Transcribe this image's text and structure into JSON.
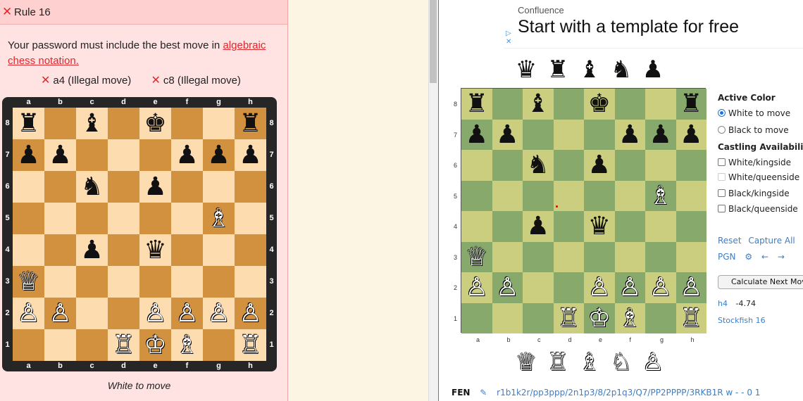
{
  "rule_card": {
    "header_icon": "✕",
    "title": "Rule 16",
    "text_before_link": "Your password must include the best move in ",
    "link_text": "algebraic chess notation.",
    "illegal_moves": [
      {
        "icon": "✕",
        "label": "a4 (Illegal move)"
      },
      {
        "icon": "✕",
        "label": "c8 (Illegal move)"
      }
    ],
    "files": [
      "a",
      "b",
      "c",
      "d",
      "e",
      "f",
      "g",
      "h"
    ],
    "ranks": [
      "8",
      "7",
      "6",
      "5",
      "4",
      "3",
      "2",
      "1"
    ],
    "status": "White to move"
  },
  "position": {
    "a8": "bR",
    "c8": "bB",
    "e8": "bK",
    "h8": "bR",
    "a7": "bP",
    "b7": "bP",
    "f7": "bP",
    "g7": "bP",
    "h7": "bP",
    "c6": "bN",
    "e6": "bP",
    "g5": "wB",
    "c4": "bP",
    "e4": "bQ",
    "a3": "wQ",
    "a2": "wP",
    "b2": "wP",
    "e2": "wP",
    "f2": "wP",
    "g2": "wP",
    "h2": "wP",
    "d1": "wR",
    "e1": "wK",
    "f1": "wB",
    "h1": "wR"
  },
  "ad": {
    "subtitle": "Confluence",
    "title": "Start with a template for free",
    "icons": [
      "▷",
      "✕"
    ]
  },
  "analysis": {
    "captured_white_pieces": [
      "wQ",
      "wR",
      "wB",
      "wN",
      "wP"
    ],
    "captured_black_pieces": [
      "bQ",
      "bR",
      "bB",
      "bN",
      "bP"
    ],
    "board_files": [
      "a",
      "b",
      "c",
      "d",
      "e",
      "f",
      "g",
      "h"
    ],
    "board_ranks": [
      "8",
      "7",
      "6",
      "5",
      "4",
      "3",
      "2",
      "1"
    ],
    "active_color_heading": "Active Color",
    "active_color_options": [
      {
        "label": "White to move",
        "selected": true
      },
      {
        "label": "Black to move",
        "selected": false
      }
    ],
    "castling_heading": "Castling Availability",
    "castling_options": [
      {
        "label": "White/kingside",
        "checked": false,
        "disabled": false
      },
      {
        "label": "White/queenside",
        "checked": false,
        "disabled": true
      },
      {
        "label": "Black/kingside",
        "checked": false,
        "disabled": false
      },
      {
        "label": "Black/queenside",
        "checked": false,
        "disabled": false
      }
    ],
    "reset_label": "Reset",
    "capture_all_label": "Capture All",
    "pgn_label": "PGN",
    "settings_icon": "⚙",
    "back_icon": "←",
    "forward_icon": "→",
    "calculate_label": "Calculate Next Move",
    "best_move": "h4",
    "evaluation": "-4.74",
    "engine": "Stockfish 16",
    "fen_label": "FEN",
    "fen_edit_icon": "✎",
    "fen_value": "r1b1k2r/pp3ppp/2n1p3/8/2p1q3/Q7/PP2PPPP/3RKB1R w - - 0 1"
  },
  "piece_glyphs": {
    "wK": "♔",
    "wQ": "♕",
    "wR": "♖",
    "wB": "♗",
    "wN": "♘",
    "wP": "♙",
    "bK": "♚",
    "bQ": "♛",
    "bR": "♜",
    "bB": "♝",
    "bN": "♞",
    "bP": "♟"
  },
  "colors": {
    "accent_red": "#e0282e",
    "link_blue": "#3c7ec6",
    "left_light": "#fddcaf",
    "left_dark": "#d1913f",
    "right_light": "#cbce7e",
    "right_dark": "#87a96b"
  }
}
